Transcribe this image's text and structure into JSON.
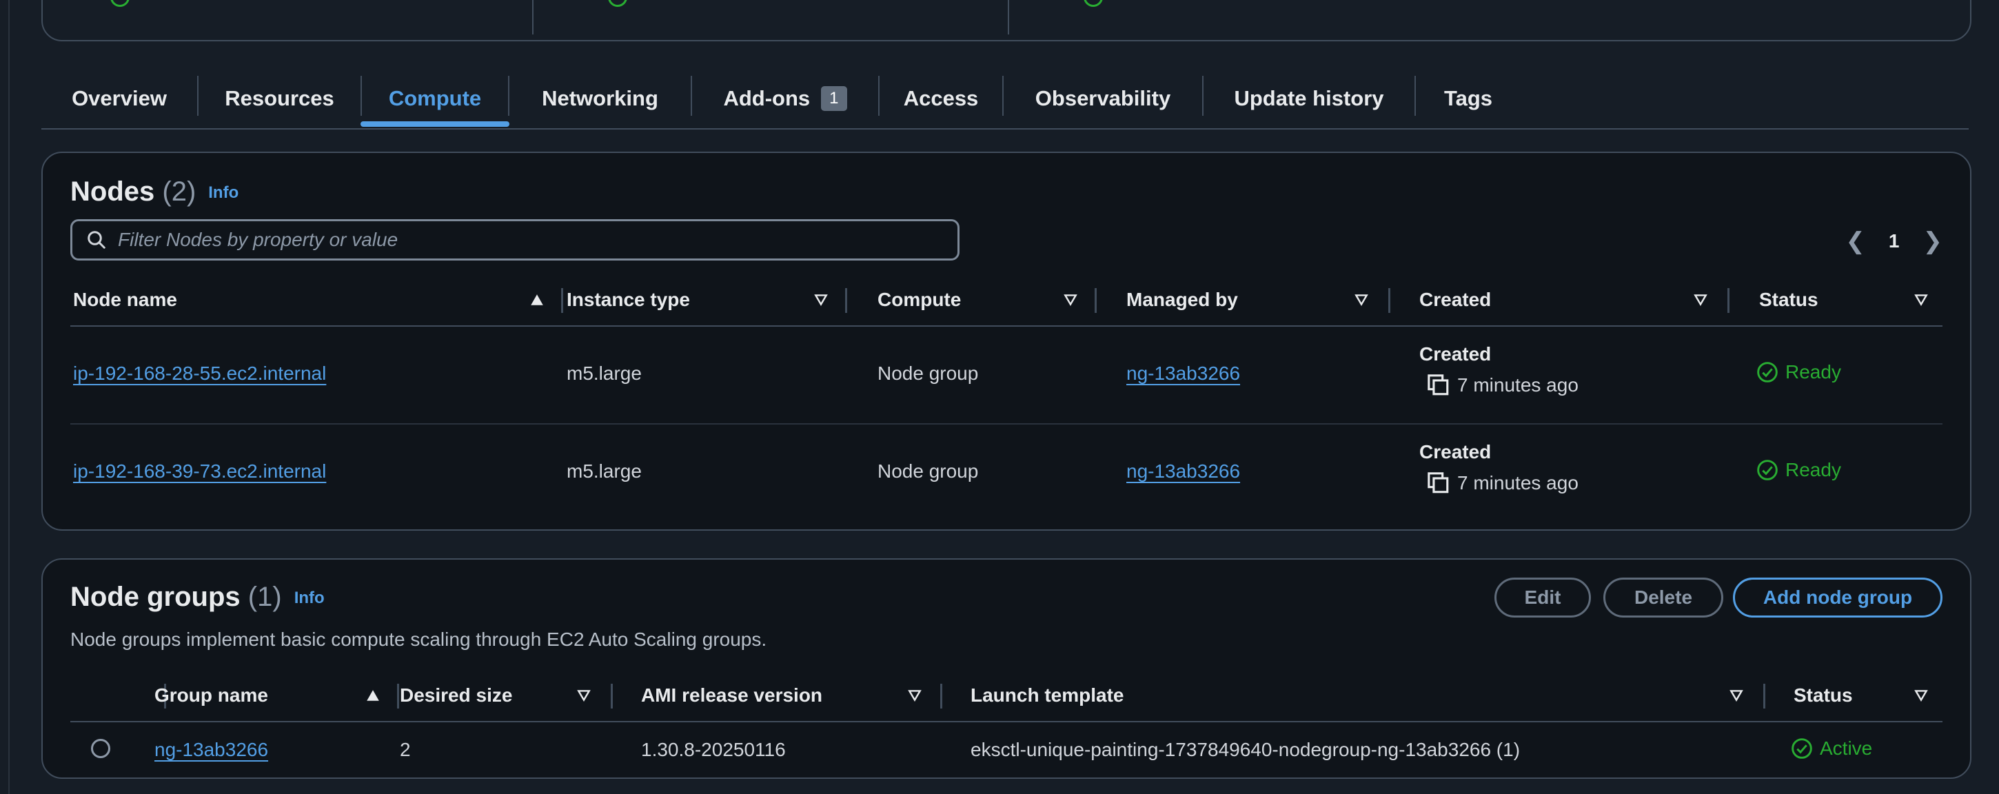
{
  "tabs": [
    {
      "label": "Overview"
    },
    {
      "label": "Resources"
    },
    {
      "label": "Compute"
    },
    {
      "label": "Networking"
    },
    {
      "label": "Add-ons",
      "badge": "1"
    },
    {
      "label": "Access"
    },
    {
      "label": "Observability"
    },
    {
      "label": "Update history"
    },
    {
      "label": "Tags"
    }
  ],
  "active_tab": "Compute",
  "nodes": {
    "title": "Nodes",
    "count": "(2)",
    "info": "Info",
    "search_placeholder": "Filter Nodes by property or value",
    "page": "1",
    "columns": [
      "Node name",
      "Instance type",
      "Compute",
      "Managed by",
      "Created",
      "Status"
    ],
    "rows": [
      {
        "name": "ip-192-168-28-55.ec2.internal",
        "instance_type": "m5.large",
        "compute": "Node group",
        "managed_by": "ng-13ab3266",
        "created_label": "Created",
        "created": "7 minutes ago",
        "status": "Ready"
      },
      {
        "name": "ip-192-168-39-73.ec2.internal",
        "instance_type": "m5.large",
        "compute": "Node group",
        "managed_by": "ng-13ab3266",
        "created_label": "Created",
        "created": "7 minutes ago",
        "status": "Ready"
      }
    ]
  },
  "node_groups": {
    "title": "Node groups",
    "count": "(1)",
    "info": "Info",
    "description": "Node groups implement basic compute scaling through EC2 Auto Scaling groups.",
    "buttons": {
      "edit": "Edit",
      "delete": "Delete",
      "add": "Add node group"
    },
    "columns": [
      "Group name",
      "Desired size",
      "AMI release version",
      "Launch template",
      "Status"
    ],
    "rows": [
      {
        "name": "ng-13ab3266",
        "desired_size": "2",
        "ami": "1.30.8-20250116",
        "launch_template": "eksctl-unique-painting-1737849640-nodegroup-ng-13ab3266 (1)",
        "status": "Active"
      }
    ]
  },
  "colors": {
    "accent": "#539fe5",
    "success": "#29ad32",
    "background": "#161d26",
    "card": "#0f141a"
  },
  "icons": {
    "search": "search-icon",
    "copy": "copy-icon",
    "status": "check-circle-icon",
    "sort_asc": "sort-ascending-icon",
    "sort": "sort-icon",
    "prev": "chevron-left-icon",
    "next": "chevron-right-icon"
  }
}
